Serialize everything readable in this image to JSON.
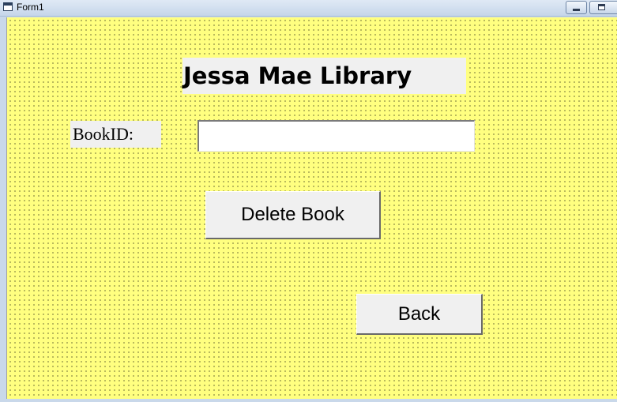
{
  "window": {
    "title": "Form1",
    "icon": "form-window-icon",
    "controls": [
      "minimize-icon",
      "maximize-icon"
    ]
  },
  "form": {
    "background_color": "#ffff80",
    "heading": "Jessa Mae Library",
    "book_id_label": "BookID:",
    "book_id_value": "",
    "delete_button": "Delete Book",
    "back_button": "Back"
  }
}
